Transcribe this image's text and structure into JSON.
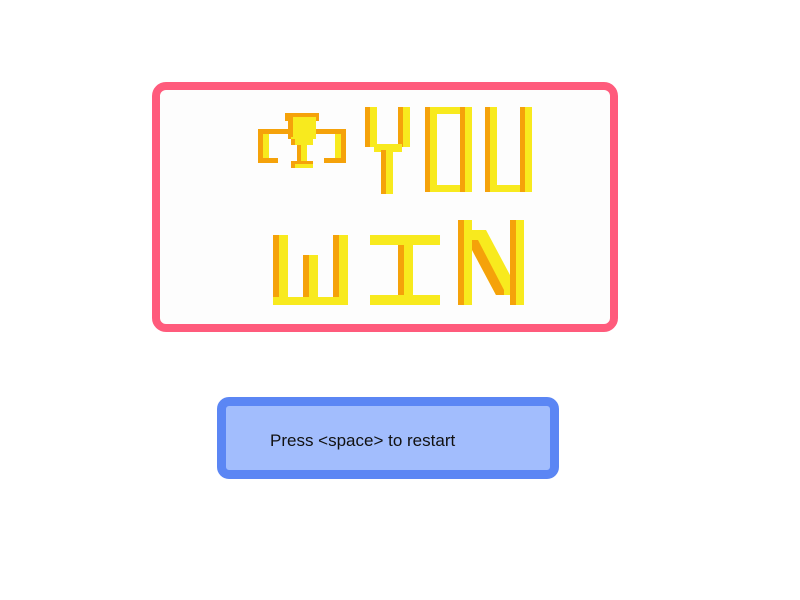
{
  "banner": {
    "line1": "YOU",
    "line2": "WIN",
    "icon": "trophy-icon",
    "colors": {
      "border": "#ff5b7c",
      "background": "#fdfdfd",
      "letter_fill": "#f8ea1e",
      "letter_shadow": "#f5a20a"
    }
  },
  "prompt": {
    "text": "Press <space> to restart",
    "colors": {
      "border": "#5b86f4",
      "background": "#a2bdfd"
    }
  }
}
